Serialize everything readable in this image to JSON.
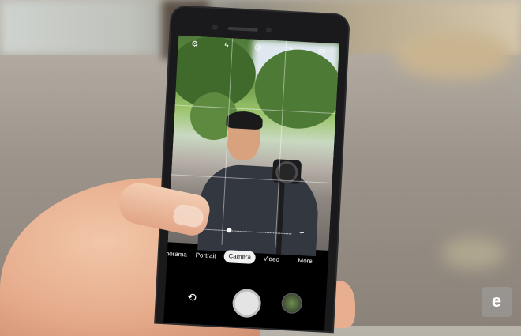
{
  "camera_app": {
    "top_icons": [
      "settings-icon",
      "flash-off-icon",
      "motion-icon",
      "timer-icon",
      "aspect-ratio-icon"
    ],
    "modes": {
      "panorama": "norama",
      "portrait": "Portrait",
      "camera": "Camera",
      "video": "Video",
      "more": "More"
    },
    "zoom_minus": "−",
    "zoom_plus": "+"
  },
  "watermark": {
    "logo": "e"
  }
}
